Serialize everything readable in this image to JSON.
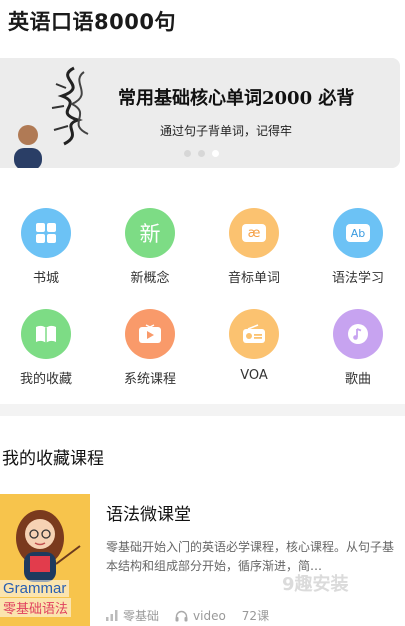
{
  "page": {
    "title": "英语口语8000句"
  },
  "banner": {
    "headline": "常用基础核心单词2000  必背",
    "subline": "通过句子背单词，记得牢",
    "dots": 3,
    "active_dot": 2
  },
  "categories": [
    {
      "label": "书城",
      "icon": "grid-icon",
      "color": "#6cc2f5",
      "glyph": ""
    },
    {
      "label": "新概念",
      "icon": "new-icon",
      "color": "#7ddc85",
      "glyph": "新"
    },
    {
      "label": "音标单词",
      "icon": "phonetic-icon",
      "color": "#fbc270",
      "glyph": "æ"
    },
    {
      "label": "语法学习",
      "icon": "ab-icon",
      "color": "#6cc2f5",
      "glyph": "Ab"
    },
    {
      "label": "我的收藏",
      "icon": "book-icon",
      "color": "#7ddc85",
      "glyph": ""
    },
    {
      "label": "系统课程",
      "icon": "play-icon",
      "color": "#f99a6a",
      "glyph": ""
    },
    {
      "label": "VOA",
      "icon": "radio-icon",
      "color": "#fbc270",
      "glyph": ""
    },
    {
      "label": "歌曲",
      "icon": "music-icon",
      "color": "#c7a3f0",
      "glyph": ""
    }
  ],
  "favorites": {
    "section_title": "我的收藏课程",
    "course": {
      "name": "语法微课堂",
      "description": "零基础开始入门的英语必学课程，核心课程。从句子基本结构和组成部分开始，循序渐进，简…",
      "cover_text_en": "Grammar",
      "cover_text_cn": "零基础语法",
      "level": "零基础",
      "media": "video",
      "lessons": "72课"
    }
  },
  "watermark": "9趣安装"
}
